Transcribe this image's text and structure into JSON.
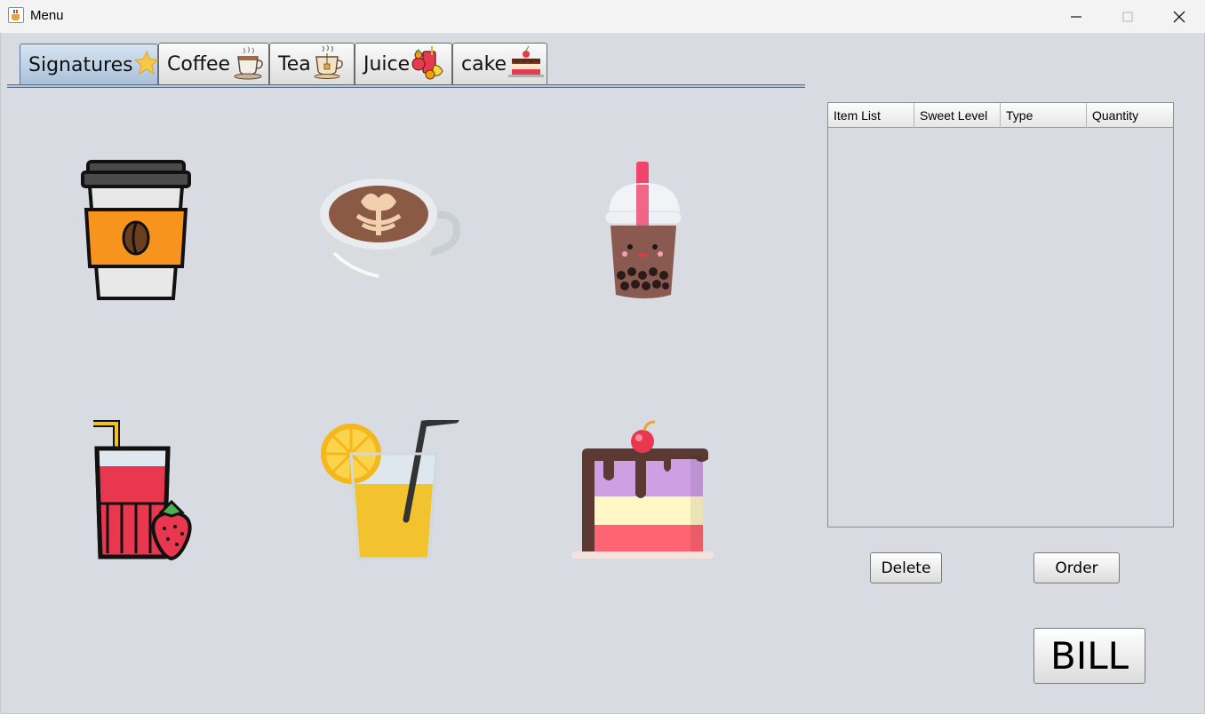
{
  "window": {
    "title": "Menu"
  },
  "tabs": [
    {
      "label": "Signatures",
      "icon": "star-icon",
      "active": true
    },
    {
      "label": "Coffee",
      "icon": "coffee-cup-icon",
      "active": false
    },
    {
      "label": "Tea",
      "icon": "tea-cup-icon",
      "active": false
    },
    {
      "label": "Juice",
      "icon": "juice-icon",
      "active": false
    },
    {
      "label": "cake",
      "icon": "cake-icon",
      "active": false
    }
  ],
  "items": [
    {
      "name": "takeaway-coffee",
      "icon": "takeaway-coffee-icon"
    },
    {
      "name": "latte",
      "icon": "latte-icon"
    },
    {
      "name": "bubble-tea",
      "icon": "bubble-tea-icon"
    },
    {
      "name": "strawberry-juice",
      "icon": "strawberry-juice-icon"
    },
    {
      "name": "lemonade",
      "icon": "lemonade-icon"
    },
    {
      "name": "layer-cake",
      "icon": "layer-cake-icon"
    }
  ],
  "table": {
    "columns": [
      "Item List",
      "Sweet Level",
      "Type",
      "Quantity"
    ],
    "rows": []
  },
  "buttons": {
    "delete": "Delete",
    "order": "Order",
    "bill": "BILL"
  }
}
